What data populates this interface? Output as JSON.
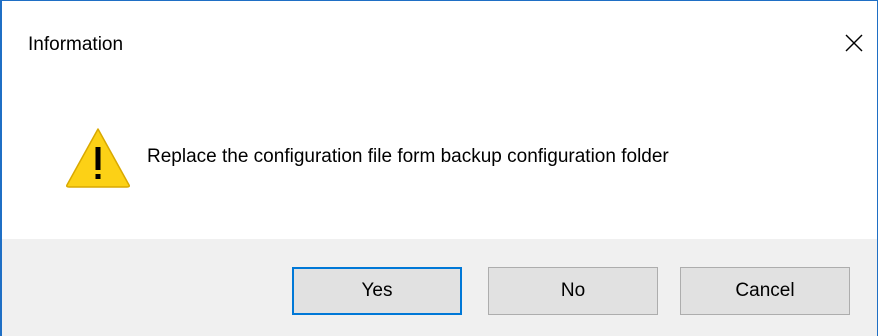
{
  "window": {
    "title": "Information",
    "close_glyph": "✕"
  },
  "message": {
    "icon": "warning-icon",
    "text": "Replace the configuration file form backup configuration folder"
  },
  "buttons": {
    "yes_label": "Yes",
    "no_label": "No",
    "cancel_label": "Cancel"
  },
  "colors": {
    "accent": "#0078d7",
    "warning_fill": "#fcd116",
    "footer_bg": "#f0f0f0",
    "button_bg": "#e1e1e1"
  }
}
